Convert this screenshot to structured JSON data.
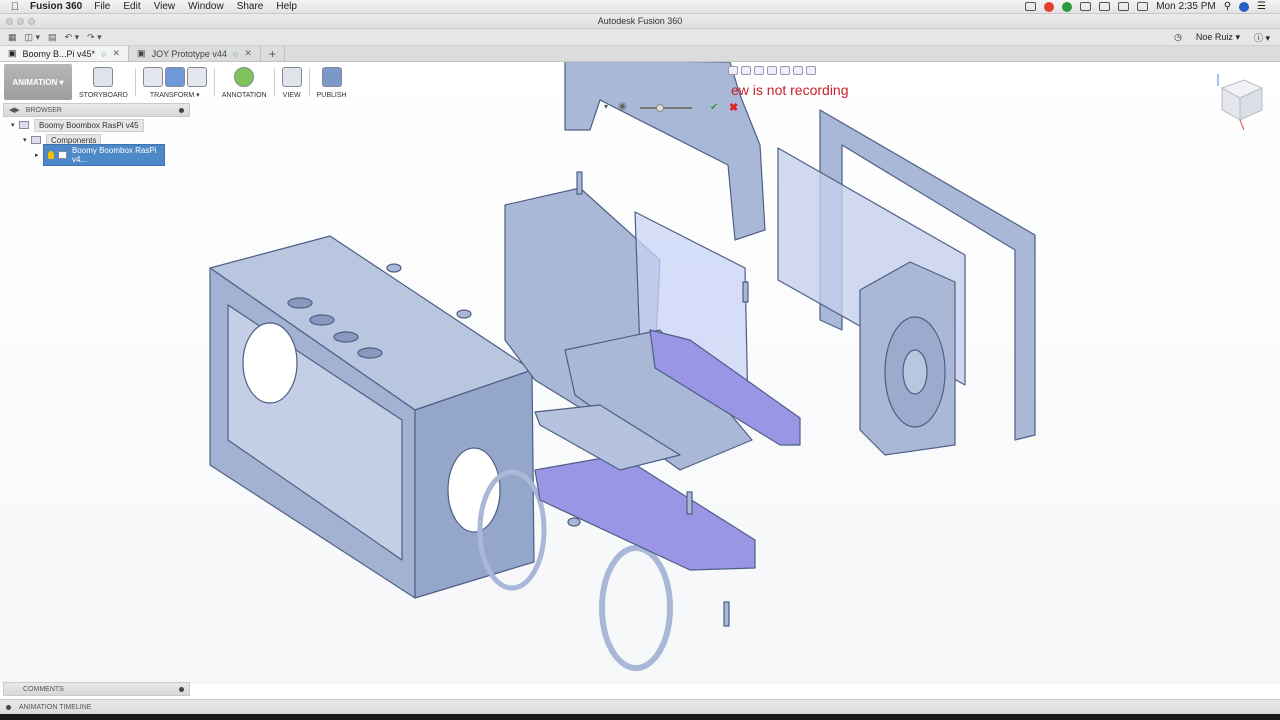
{
  "mac_menu": {
    "app": "Fusion 360",
    "items": [
      "File",
      "Edit",
      "View",
      "Window",
      "Share",
      "Help"
    ],
    "clock": "Mon 2:35 PM"
  },
  "window_title": "Autodesk Fusion 360",
  "quick_access": {
    "user": "Noe Ruiz"
  },
  "doc_tabs": [
    {
      "label": "Boomy B...Pi v45*"
    },
    {
      "label": "JOY Prototype v44"
    }
  ],
  "toolbar": {
    "workspace": "ANIMATION",
    "storyboard": "STORYBOARD",
    "transform": "TRANSFORM",
    "annotation": "ANNOTATION",
    "view": "VIEW",
    "publish": "PUBLISH"
  },
  "browser": {
    "title": "BROWSER",
    "root": "Boomy Boombox RasPi v45",
    "components": "Components",
    "selected": "Boomy Boombox RasPi v4..."
  },
  "comments_title": "COMMENTS",
  "timeline_title": "ANIMATION TIMELINE",
  "recording_message": "ew is not recording",
  "colors": {
    "part_fill": "#a9b8d6",
    "part_stroke": "#4e5f86",
    "purple_part": "#9b95e6",
    "accent_blue": "#4d88c8"
  }
}
